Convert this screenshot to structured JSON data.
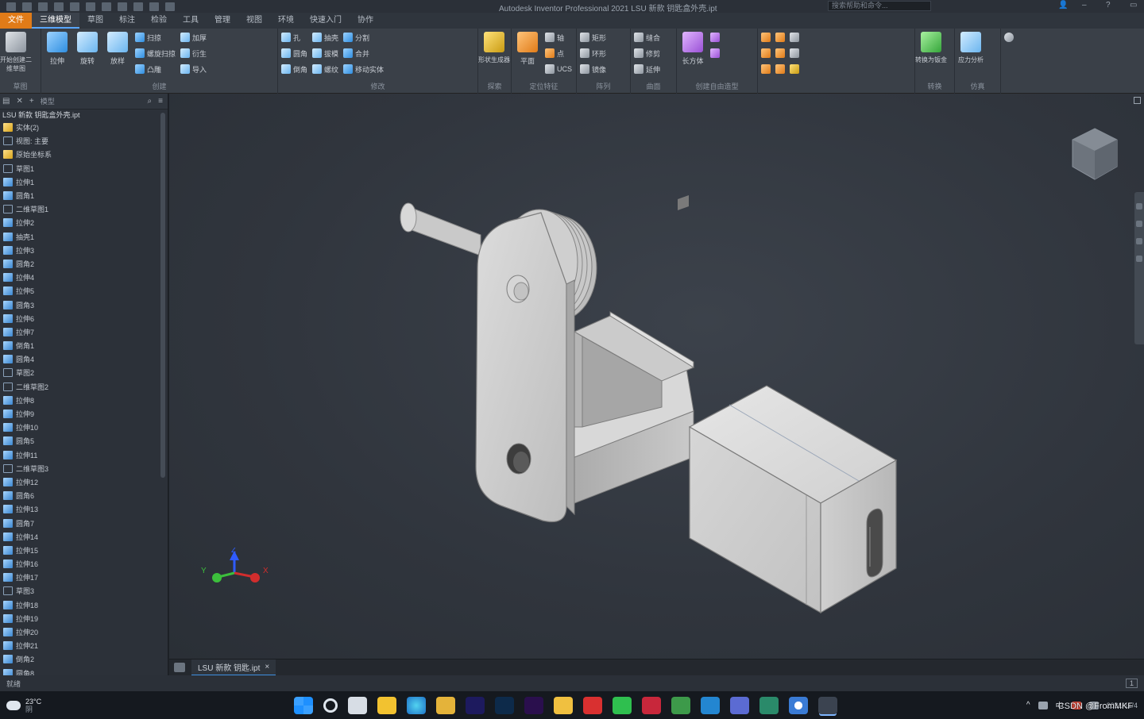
{
  "titlebar": {
    "title": "Autodesk Inventor Professional 2021   LSU 新款 钥匙盒外壳.ipt",
    "search_placeholder": "搜索帮助和命令..."
  },
  "tabs": [
    {
      "label": "文件",
      "kind": "file"
    },
    {
      "label": "三维模型",
      "kind": "active"
    },
    {
      "label": "草图",
      "kind": ""
    },
    {
      "label": "标注",
      "kind": ""
    },
    {
      "label": "检验",
      "kind": ""
    },
    {
      "label": "工具",
      "kind": ""
    },
    {
      "label": "管理",
      "kind": ""
    },
    {
      "label": "视图",
      "kind": ""
    },
    {
      "label": "环境",
      "kind": ""
    },
    {
      "label": "快速入门",
      "kind": ""
    },
    {
      "label": "协作",
      "kind": ""
    }
  ],
  "ribbon": {
    "sketch": {
      "title": "草图",
      "big": "开始创建二维草图"
    },
    "create": {
      "title": "创建",
      "big1": "拉伸",
      "big2": "旋转",
      "big3": "放样",
      "small": [
        "扫掠",
        "螺旋扫掠",
        "凸雕",
        "加厚",
        "衍生",
        "导入"
      ]
    },
    "modify": {
      "title": "修改",
      "small": [
        "孔",
        "圆角",
        "倒角",
        "抽壳",
        "拔模",
        "螺纹",
        "分割",
        "合并",
        "移动实体"
      ]
    },
    "explore": {
      "title": "探索",
      "big": "形状生成器"
    },
    "work": {
      "title": "定位特征",
      "small": [
        "平面",
        "轴",
        "点",
        "UCS"
      ]
    },
    "pattern": {
      "title": "阵列",
      "small": [
        "矩形",
        "环形",
        "镜像"
      ]
    },
    "surface": {
      "title": "曲面",
      "small": [
        "缝合",
        "修剪",
        "延伸"
      ]
    },
    "freeform": {
      "title": "创建自由造型",
      "big": "长方体"
    },
    "convert": {
      "title": "转换",
      "big": "转换为钣金"
    },
    "simulate": {
      "title": "仿真",
      "big": "应力分析"
    }
  },
  "browser": {
    "header": "模型",
    "root": "LSU 新款 钥匙盒外壳.ipt",
    "items": [
      {
        "label": "实体(2)",
        "icon": "folder"
      },
      {
        "label": "视图: 主要",
        "icon": "sketch"
      },
      {
        "label": "原始坐标系",
        "icon": "folder"
      },
      {
        "label": "草图1",
        "icon": "sketch"
      },
      {
        "label": "拉伸1",
        "icon": "part"
      },
      {
        "label": "圆角1",
        "icon": "part"
      },
      {
        "label": "二维草图1",
        "icon": "sketch"
      },
      {
        "label": "拉伸2",
        "icon": "part"
      },
      {
        "label": "抽壳1",
        "icon": "part"
      },
      {
        "label": "拉伸3",
        "icon": "part"
      },
      {
        "label": "圆角2",
        "icon": "part"
      },
      {
        "label": "拉伸4",
        "icon": "part"
      },
      {
        "label": "拉伸5",
        "icon": "part"
      },
      {
        "label": "圆角3",
        "icon": "part"
      },
      {
        "label": "拉伸6",
        "icon": "part"
      },
      {
        "label": "拉伸7",
        "icon": "part"
      },
      {
        "label": "倒角1",
        "icon": "part"
      },
      {
        "label": "圆角4",
        "icon": "part"
      },
      {
        "label": "草图2",
        "icon": "sketch"
      },
      {
        "label": "二维草图2",
        "icon": "sketch"
      },
      {
        "label": "拉伸8",
        "icon": "part"
      },
      {
        "label": "拉伸9",
        "icon": "part"
      },
      {
        "label": "拉伸10",
        "icon": "part"
      },
      {
        "label": "圆角5",
        "icon": "part"
      },
      {
        "label": "拉伸11",
        "icon": "part"
      },
      {
        "label": "二维草图3",
        "icon": "sketch"
      },
      {
        "label": "拉伸12",
        "icon": "part"
      },
      {
        "label": "圆角6",
        "icon": "part"
      },
      {
        "label": "拉伸13",
        "icon": "part"
      },
      {
        "label": "圆角7",
        "icon": "part"
      },
      {
        "label": "拉伸14",
        "icon": "part"
      },
      {
        "label": "拉伸15",
        "icon": "part"
      },
      {
        "label": "拉伸16",
        "icon": "part"
      },
      {
        "label": "拉伸17",
        "icon": "part"
      },
      {
        "label": "草图3",
        "icon": "sketch"
      },
      {
        "label": "拉伸18",
        "icon": "part"
      },
      {
        "label": "拉伸19",
        "icon": "part"
      },
      {
        "label": "拉伸20",
        "icon": "part"
      },
      {
        "label": "拉伸21",
        "icon": "part"
      },
      {
        "label": "倒角2",
        "icon": "part"
      },
      {
        "label": "圆角8",
        "icon": "part"
      }
    ]
  },
  "viewport": {
    "triad": {
      "x": "X",
      "y": "Y",
      "z": "Z"
    }
  },
  "doctab": {
    "label": "LSU 新款 钥匙.ipt"
  },
  "statusbar": {
    "left": "就绪",
    "page": "1"
  },
  "taskbar": {
    "weather": "23°C",
    "weather_sub": "阴",
    "time": "2021/11/4",
    "tray_lang": "中"
  },
  "watermark": "CSDN @FromMKF"
}
